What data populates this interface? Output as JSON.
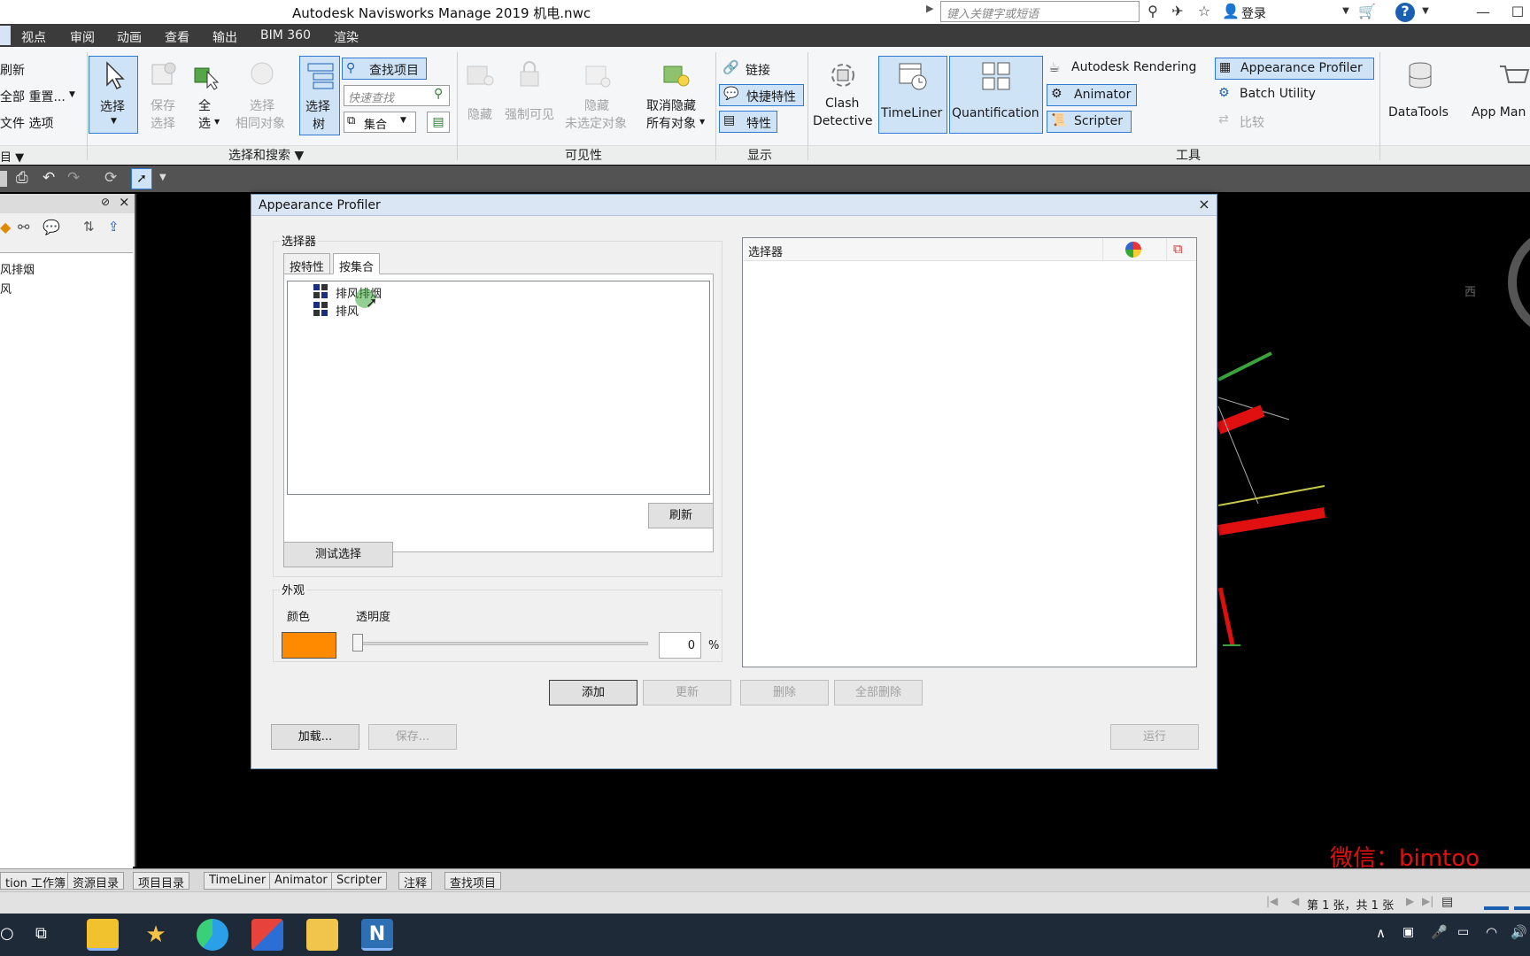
{
  "window": {
    "title": "Autodesk Navisworks Manage 2019    机电.nwc",
    "search_placeholder": "键入关键字或短语",
    "login": "登录"
  },
  "menu": [
    "视点",
    "审阅",
    "动画",
    "查看",
    "输出",
    "BIM 360",
    "渲染"
  ],
  "ribbon": {
    "left_partial": {
      "refresh": "刷新",
      "reset_all": "全部 重置...",
      "file_options": "文件 选项"
    },
    "select_search": {
      "select": "选择",
      "save_selection_l1": "保存",
      "save_selection_l2": "选择",
      "select_all_l1": "全",
      "select_all_l2": "选",
      "select_same_l1": "选择",
      "select_same_l2": "相同对象",
      "selection_tree_l1": "选择",
      "selection_tree_l2": "树",
      "find_items": "查找项目",
      "quick_find_placeholder": "快速查找",
      "sets": "集合",
      "group_title": "选择和搜索"
    },
    "visibility": {
      "hide": "隐藏",
      "require": "强制可见",
      "hide_unselected_l1": "隐藏",
      "hide_unselected_l2": "未选定对象",
      "unhide_all_l1": "取消隐藏",
      "unhide_all_l2": "所有对象",
      "group_title": "可见性"
    },
    "display": {
      "links": "链接",
      "quick_properties": "快捷特性",
      "properties": "特性",
      "group_title": "显示"
    },
    "tools": {
      "clash_l1": "Clash",
      "clash_l2": "Detective",
      "timeliner": "TimeLiner",
      "quantification": "Quantification",
      "autodesk_rendering": "Autodesk Rendering",
      "animator": "Animator",
      "scripter": "Scripter",
      "appearance_profiler": "Appearance Profiler",
      "batch_utility": "Batch Utility",
      "compare": "比较",
      "datatools": "DataTools",
      "app_manager": "App Man",
      "group_title": "工具"
    }
  },
  "left_panel": {
    "tree_items": [
      "风排烟",
      "风"
    ]
  },
  "dialog": {
    "title": "Appearance Profiler",
    "selector_group": "选择器",
    "tabs": [
      "按特性",
      "按集合"
    ],
    "active_tab": 1,
    "set_list": [
      "排风排烟",
      "排风"
    ],
    "refresh": "刷新",
    "test_selection": "测试选择",
    "appearance_group": "外观",
    "color_label": "颜色",
    "color_value": "#ff8a00",
    "transparency_label": "透明度",
    "transparency_value": "0",
    "percent": "%",
    "selector_list_header": "选择器",
    "add": "添加",
    "update": "更新",
    "delete": "删除",
    "delete_all": "全部删除",
    "load": "加载...",
    "save": "保存...",
    "run": "运行"
  },
  "bottom_tabs": [
    "tion 工作簿",
    "资源目录",
    "项目目录",
    "TimeLiner",
    "Animator",
    "Scripter",
    "注释",
    "查找项目"
  ],
  "status": {
    "page": "第 1 张，共 1 张"
  },
  "watermark": "微信：bimtoo",
  "viewcube_label": "西"
}
